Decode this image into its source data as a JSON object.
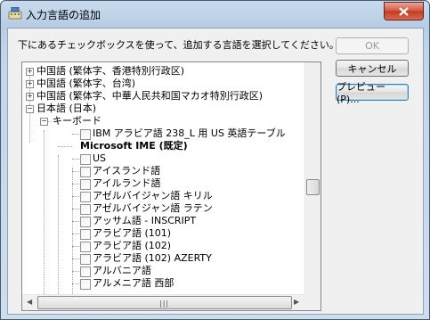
{
  "window": {
    "title": "入力言語の追加"
  },
  "instruction": "下にあるチェックボックスを使って、追加する言語を選択してください。",
  "buttons": {
    "ok": "OK",
    "cancel": "キャンセル",
    "preview": "プレビュー(P)..."
  },
  "tree": {
    "rows": [
      {
        "label": "中国語 (繁体字、香港特別行政区)",
        "kind": "collapsed"
      },
      {
        "label": "中国語 (繁体字、台湾)",
        "kind": "collapsed"
      },
      {
        "label": "中国語 (繁体字、中華人民共和国マカオ特別行政区)",
        "kind": "collapsed"
      },
      {
        "label": "日本語 (日本)",
        "kind": "expanded"
      },
      {
        "label": "キーボード",
        "kind": "expanded-child"
      },
      {
        "label": "IBM アラビア語 238_L 用 US 英語テーブル",
        "kind": "checkbox"
      },
      {
        "label": "Microsoft IME (既定)",
        "kind": "bold"
      },
      {
        "label": "US",
        "kind": "checkbox"
      },
      {
        "label": "アイスランド語",
        "kind": "checkbox"
      },
      {
        "label": "アイルランド語",
        "kind": "checkbox"
      },
      {
        "label": "アゼルバイジャン語 キリル",
        "kind": "checkbox"
      },
      {
        "label": "アゼルバイジャン語 ラテン",
        "kind": "checkbox"
      },
      {
        "label": "アッサム語 - INSCRIPT",
        "kind": "checkbox"
      },
      {
        "label": "アラビア語 (101)",
        "kind": "checkbox"
      },
      {
        "label": "アラビア語 (102)",
        "kind": "checkbox"
      },
      {
        "label": "アラビア語 (102) AZERTY",
        "kind": "checkbox"
      },
      {
        "label": "アルバニア語",
        "kind": "checkbox"
      },
      {
        "label": "アルメニア語 西部",
        "kind": "checkbox"
      }
    ]
  }
}
